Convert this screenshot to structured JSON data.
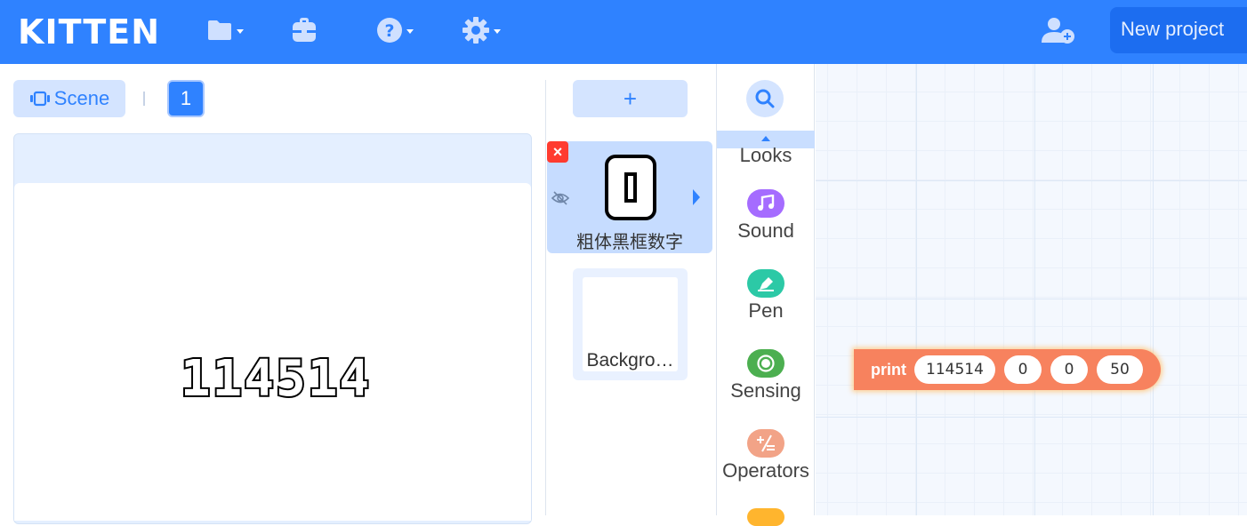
{
  "header": {
    "logo": "KITTEN",
    "new_project_label": "New project",
    "icons": [
      "folder-icon",
      "backpack-icon",
      "help-icon",
      "settings-icon",
      "add-user-icon"
    ]
  },
  "scene": {
    "scene_label": "Scene",
    "active_scene": "1"
  },
  "stage": {
    "display_text": "114514"
  },
  "sprites": {
    "add_label": "+",
    "delete_label": "×",
    "selected_sprite": {
      "name": "粗体黑框数字",
      "costume": "0"
    },
    "background": {
      "name": "Backgro…"
    }
  },
  "categories": [
    {
      "label": "Looks",
      "color": "#9b6cff",
      "icon": "looks-icon"
    },
    {
      "label": "Sound",
      "color": "#a56cff",
      "icon": "music-note-icon"
    },
    {
      "label": "Pen",
      "color": "#2cc9a6",
      "icon": "pen-icon"
    },
    {
      "label": "Sensing",
      "color": "#4caf50",
      "icon": "sensing-icon"
    },
    {
      "label": "Operators",
      "color": "#f2a387",
      "icon": "operators-icon"
    }
  ],
  "workspace": {
    "block": {
      "keyword": "print",
      "args": [
        "114514",
        "0",
        "0",
        "50"
      ],
      "color": "#f7825e"
    }
  }
}
